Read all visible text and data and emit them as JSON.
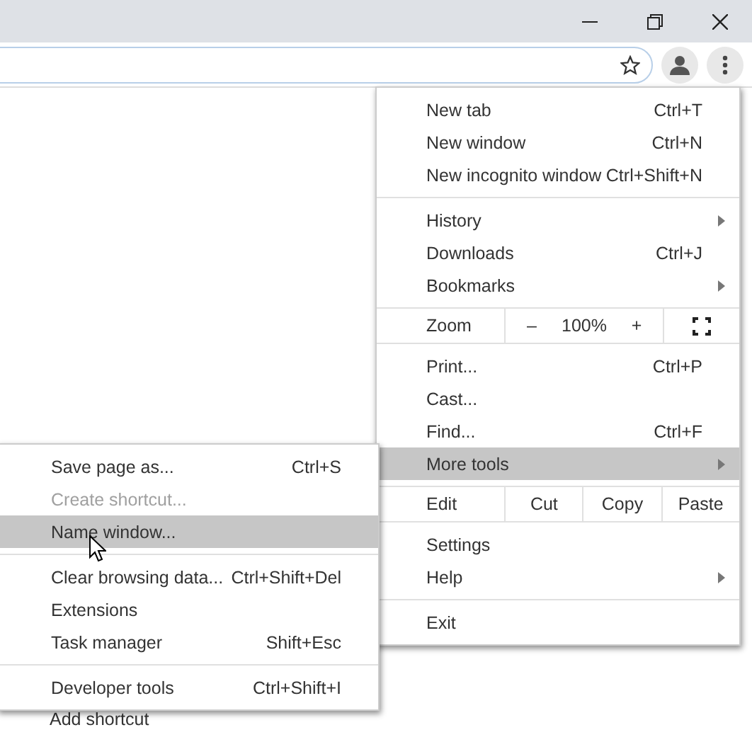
{
  "menu": {
    "items": [
      {
        "kind": "item",
        "label": "New tab",
        "shortcut": "Ctrl+T",
        "submenu": false,
        "selected": false
      },
      {
        "kind": "item",
        "label": "New window",
        "shortcut": "Ctrl+N",
        "submenu": false,
        "selected": false
      },
      {
        "kind": "item",
        "label": "New incognito window",
        "shortcut": "Ctrl+Shift+N",
        "submenu": false,
        "selected": false
      },
      {
        "kind": "separator"
      },
      {
        "kind": "item",
        "label": "History",
        "submenu": true,
        "selected": false
      },
      {
        "kind": "item",
        "label": "Downloads",
        "shortcut": "Ctrl+J",
        "submenu": false,
        "selected": false
      },
      {
        "kind": "item",
        "label": "Bookmarks",
        "submenu": true,
        "selected": false
      },
      {
        "kind": "separator"
      },
      {
        "kind": "zoom",
        "label": "Zoom",
        "minus": "–",
        "level": "100%",
        "plus": "+"
      },
      {
        "kind": "separator"
      },
      {
        "kind": "item",
        "label": "Print...",
        "shortcut": "Ctrl+P",
        "submenu": false,
        "selected": false
      },
      {
        "kind": "item",
        "label": "Cast...",
        "submenu": false,
        "selected": false
      },
      {
        "kind": "item",
        "label": "Find...",
        "shortcut": "Ctrl+F",
        "submenu": false,
        "selected": false
      },
      {
        "kind": "item",
        "label": "More tools",
        "submenu": true,
        "selected": true
      },
      {
        "kind": "separator"
      },
      {
        "kind": "edit",
        "label": "Edit",
        "actions": [
          "Cut",
          "Copy",
          "Paste"
        ]
      },
      {
        "kind": "separator"
      },
      {
        "kind": "item",
        "label": "Settings",
        "submenu": false,
        "selected": false
      },
      {
        "kind": "item",
        "label": "Help",
        "submenu": true,
        "selected": false
      },
      {
        "kind": "separator"
      },
      {
        "kind": "item",
        "label": "Exit",
        "submenu": false,
        "selected": false
      }
    ]
  },
  "submenu": {
    "items": [
      {
        "kind": "item",
        "label": "Save page as...",
        "shortcut": "Ctrl+S",
        "disabled": false,
        "selected": false
      },
      {
        "kind": "item",
        "label": "Create shortcut...",
        "disabled": true,
        "selected": false
      },
      {
        "kind": "item",
        "label": "Name window...",
        "disabled": false,
        "selected": true
      },
      {
        "kind": "separator"
      },
      {
        "kind": "item",
        "label": "Clear browsing data...",
        "shortcut": "Ctrl+Shift+Del",
        "disabled": false,
        "selected": false
      },
      {
        "kind": "item",
        "label": "Extensions",
        "disabled": false,
        "selected": false
      },
      {
        "kind": "item",
        "label": "Task manager",
        "shortcut": "Shift+Esc",
        "disabled": false,
        "selected": false
      },
      {
        "kind": "separator"
      },
      {
        "kind": "item",
        "label": "Developer tools",
        "shortcut": "Ctrl+Shift+I",
        "disabled": false,
        "selected": false
      }
    ]
  },
  "page": {
    "text": "Add shortcut"
  }
}
